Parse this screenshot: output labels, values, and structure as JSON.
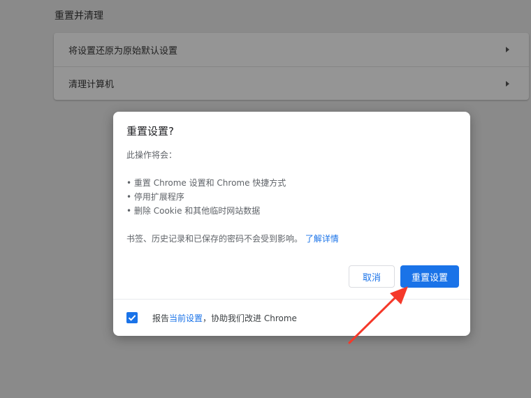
{
  "section": {
    "title": "重置并清理"
  },
  "card": {
    "items": [
      {
        "label": "将设置还原为原始默认设置"
      },
      {
        "label": "清理计算机"
      }
    ]
  },
  "dialog": {
    "title": "重置设置?",
    "intro": "此操作将会：",
    "bullets": [
      "重置 Chrome 设置和 Chrome 快捷方式",
      "停用扩展程序",
      "删除 Cookie 和其他临时网站数据"
    ],
    "note": "书签、历史记录和已保存的密码不会受到影响。",
    "learn_more": "了解详情",
    "cancel_label": "取消",
    "reset_label": "重置设置",
    "footer": {
      "checked": true,
      "prefix": "报告",
      "link": "当前设置",
      "suffix": "，协助我们改进 Chrome"
    }
  },
  "colors": {
    "accent": "#1a73e8",
    "annotation_arrow": "#f5392a",
    "overlay": "#8a8a8a"
  },
  "icons": {
    "chevron": "chevron-right-icon",
    "checkbox": "check-icon"
  }
}
